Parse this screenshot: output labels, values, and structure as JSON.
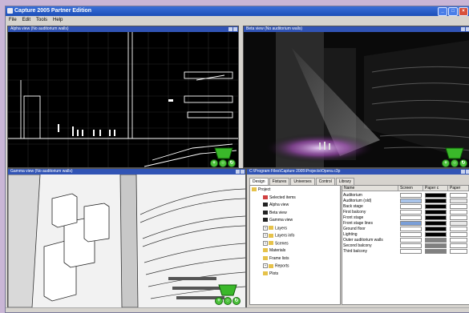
{
  "window": {
    "title": "Capture 2005 Partner Edition"
  },
  "menu": [
    "File",
    "Edit",
    "Tools",
    "Help"
  ],
  "panes": {
    "alpha": "Alpha view   (No auditorium walls)",
    "beta": "Beta view   (No auditorium walls)",
    "gamma": "Gamma view   (No auditorium walls)",
    "browser": "C:\\Program Files\\Capture 2005\\Projects\\Opera.c3p"
  },
  "tabs": [
    "Design",
    "Fixtures",
    "Universes",
    "Control",
    "Library"
  ],
  "tree": [
    {
      "label": "Project",
      "indent": 0,
      "icon": "folder-icon"
    },
    {
      "label": "Selected items",
      "indent": 1,
      "icon": "selection-icon"
    },
    {
      "label": "Alpha view",
      "indent": 1,
      "icon": "view-icon"
    },
    {
      "label": "Beta view",
      "indent": 1,
      "icon": "view-icon"
    },
    {
      "label": "Gamma view",
      "indent": 1,
      "icon": "view-icon"
    },
    {
      "label": "Layers",
      "indent": 1,
      "icon": "folder-icon",
      "expand": true
    },
    {
      "label": "Layers info",
      "indent": 1,
      "icon": "folder-icon",
      "expand": true
    },
    {
      "label": "Scenes",
      "indent": 1,
      "icon": "folder-icon",
      "expand": true
    },
    {
      "label": "Materials",
      "indent": 1,
      "icon": "folder-icon"
    },
    {
      "label": "Frame lists",
      "indent": 1,
      "icon": "folder-icon"
    },
    {
      "label": "Reports",
      "indent": 1,
      "icon": "folder-icon",
      "expand": true
    },
    {
      "label": "Plots",
      "indent": 1,
      "icon": "folder-icon"
    }
  ],
  "grid": {
    "headers": [
      "Name",
      "Screen",
      "Paper c",
      "Paper"
    ],
    "rows": [
      {
        "name": "Auditorium",
        "c": [
          "#ffffff",
          "#000000",
          "#ffffff"
        ]
      },
      {
        "name": "Auditorium (old)",
        "c": [
          "#a9c4ea",
          "#000000",
          "#e8e8e8"
        ]
      },
      {
        "name": "Back stage",
        "c": [
          "#ffffff",
          "#000000",
          "#ffffff"
        ]
      },
      {
        "name": "First balcony",
        "c": [
          "#ffffff",
          "#000000",
          "#ffffff"
        ]
      },
      {
        "name": "Front stage",
        "c": [
          "#ffffff",
          "#000000",
          "#ffffff"
        ]
      },
      {
        "name": "Front stage lines",
        "c": [
          "#7a9fd8",
          "#000000",
          "#e8e8e8"
        ]
      },
      {
        "name": "Ground floor",
        "c": [
          "#ffffff",
          "#000000",
          "#ffffff"
        ]
      },
      {
        "name": "Lighting",
        "c": [
          "#ffffff",
          "#000000",
          "#ffffff"
        ]
      },
      {
        "name": "Outer auditorium walls",
        "c": [
          "#ffffff",
          "#808080",
          "#ffffff"
        ]
      },
      {
        "name": "Second balcony",
        "c": [
          "#ffffff",
          "#808080",
          "#ffffff"
        ]
      },
      {
        "name": "Third balcony",
        "c": [
          "#ffffff",
          "#808080",
          "#ffffff"
        ]
      }
    ]
  },
  "colors": {
    "titlebar": "#1c4fb8",
    "pane_header": "#3154b5",
    "accent_green": "#4bc23a"
  }
}
